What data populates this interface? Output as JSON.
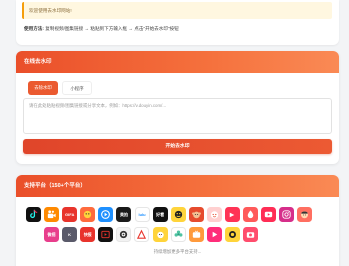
{
  "notice": {
    "text": "欢迎使用去水印网站!"
  },
  "usage": {
    "label": "使用方法:",
    "steps": "复制视频/图集链接 → 粘贴到下方输入框 → 点击“开始去水印”按钮"
  },
  "watermark": {
    "title": "在线去水印",
    "tabs": [
      {
        "label": "去除水印",
        "active": true
      },
      {
        "label": "小程序",
        "active": false
      }
    ],
    "input_placeholder": "请在此处粘贴视频/图集链接或分享文本，例如：https://v.douyin.com/...",
    "submit_label": "开始去水印"
  },
  "platforms": {
    "title": "支持平台（150+个平台）",
    "more_text": "持续增加更多平台支持...",
    "row1": [
      {
        "name": "douyin-icon",
        "bg": "#111111",
        "text": ""
      },
      {
        "name": "kuaishou-icon",
        "bg": "#ff8a00",
        "text": ""
      },
      {
        "name": "xigua-icon",
        "bg": "#e8342c",
        "text": "GIFA"
      },
      {
        "name": "pipixia-icon",
        "bg": "#ff6b3d",
        "text": ""
      },
      {
        "name": "weishi-icon",
        "bg": "#1e90ff",
        "text": ""
      },
      {
        "name": "meipai-icon",
        "bg": "#1a1a1a",
        "text": "美拍"
      },
      {
        "name": "lvzhou-icon",
        "bg": "#ffffff",
        "text": "lulu"
      },
      {
        "name": "haokan-icon",
        "bg": "#111111",
        "text": "好看"
      },
      {
        "name": "kuaiying-icon",
        "bg": "#ffd43b",
        "text": ""
      },
      {
        "name": "monkey-icon",
        "bg": "#e64b2e",
        "text": ""
      },
      {
        "name": "zuiyou-icon",
        "bg": "#ffd0d0",
        "text": ""
      },
      {
        "name": "weibo-icon",
        "bg": "#ff3355",
        "text": ""
      },
      {
        "name": "huoshan-icon",
        "bg": "#ff5a5a",
        "text": ""
      },
      {
        "name": "video-icon",
        "bg": "#ff2d55",
        "text": ""
      },
      {
        "name": "instagram-icon",
        "bg": "#d62e8a",
        "text": ""
      },
      {
        "name": "face-icon",
        "bg": "#ff6f61",
        "text": ""
      }
    ],
    "row2": [
      {
        "name": "weishi2-icon",
        "bg": "#e83e8c",
        "text": "微视"
      },
      {
        "name": "k-icon",
        "bg": "#5a5a6a",
        "text": "K"
      },
      {
        "name": "kuaibao-icon",
        "bg": "#e8342c",
        "text": "快报"
      },
      {
        "name": "screen-icon",
        "bg": "#111111",
        "text": ""
      },
      {
        "name": "eye-icon",
        "bg": "#f2f2f2",
        "text": ""
      },
      {
        "name": "acfun-icon",
        "bg": "#ffffff",
        "text": ""
      },
      {
        "name": "chick-icon",
        "bg": "#ffd43b",
        "text": ""
      },
      {
        "name": "flower-icon",
        "bg": "#ffffff",
        "text": ""
      },
      {
        "name": "tv-icon",
        "bg": "#ff9a3c",
        "text": ""
      },
      {
        "name": "play-icon",
        "bg": "#ff2d7a",
        "text": ""
      },
      {
        "name": "qq-icon",
        "bg": "#ffd43b",
        "text": ""
      },
      {
        "name": "camera-icon",
        "bg": "#ff4d6d",
        "text": ""
      }
    ]
  }
}
